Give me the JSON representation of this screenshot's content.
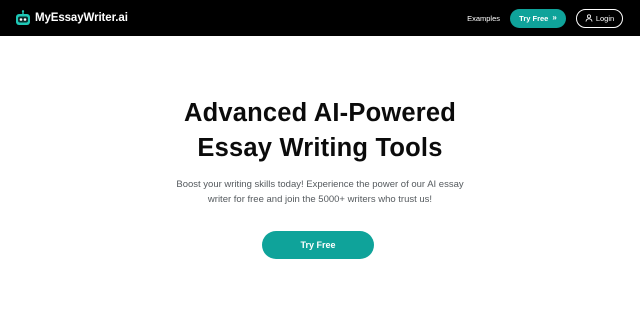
{
  "navbar": {
    "brand_name": "MyEssayWriter.ai",
    "logo_icon": "robot-icon",
    "links": {
      "examples": "Examples"
    },
    "try_free_label": "Try Free",
    "try_free_icon": "double-chevron-right-icon",
    "login_label": "Login",
    "login_icon": "user-icon"
  },
  "hero": {
    "title_line1": "Advanced AI-Powered",
    "title_line2": "Essay Writing Tools",
    "subtitle_line1": "Boost your writing skills today! Experience the power of our AI essay",
    "subtitle_line2": "writer for free and join the 5000+ writers who trust us!",
    "cta_label": "Try Free"
  },
  "colors": {
    "navbar_bg": "#000000",
    "accent": "#0fa39a",
    "title_text": "#0b0b0b",
    "subtitle_text": "#555a5e"
  }
}
